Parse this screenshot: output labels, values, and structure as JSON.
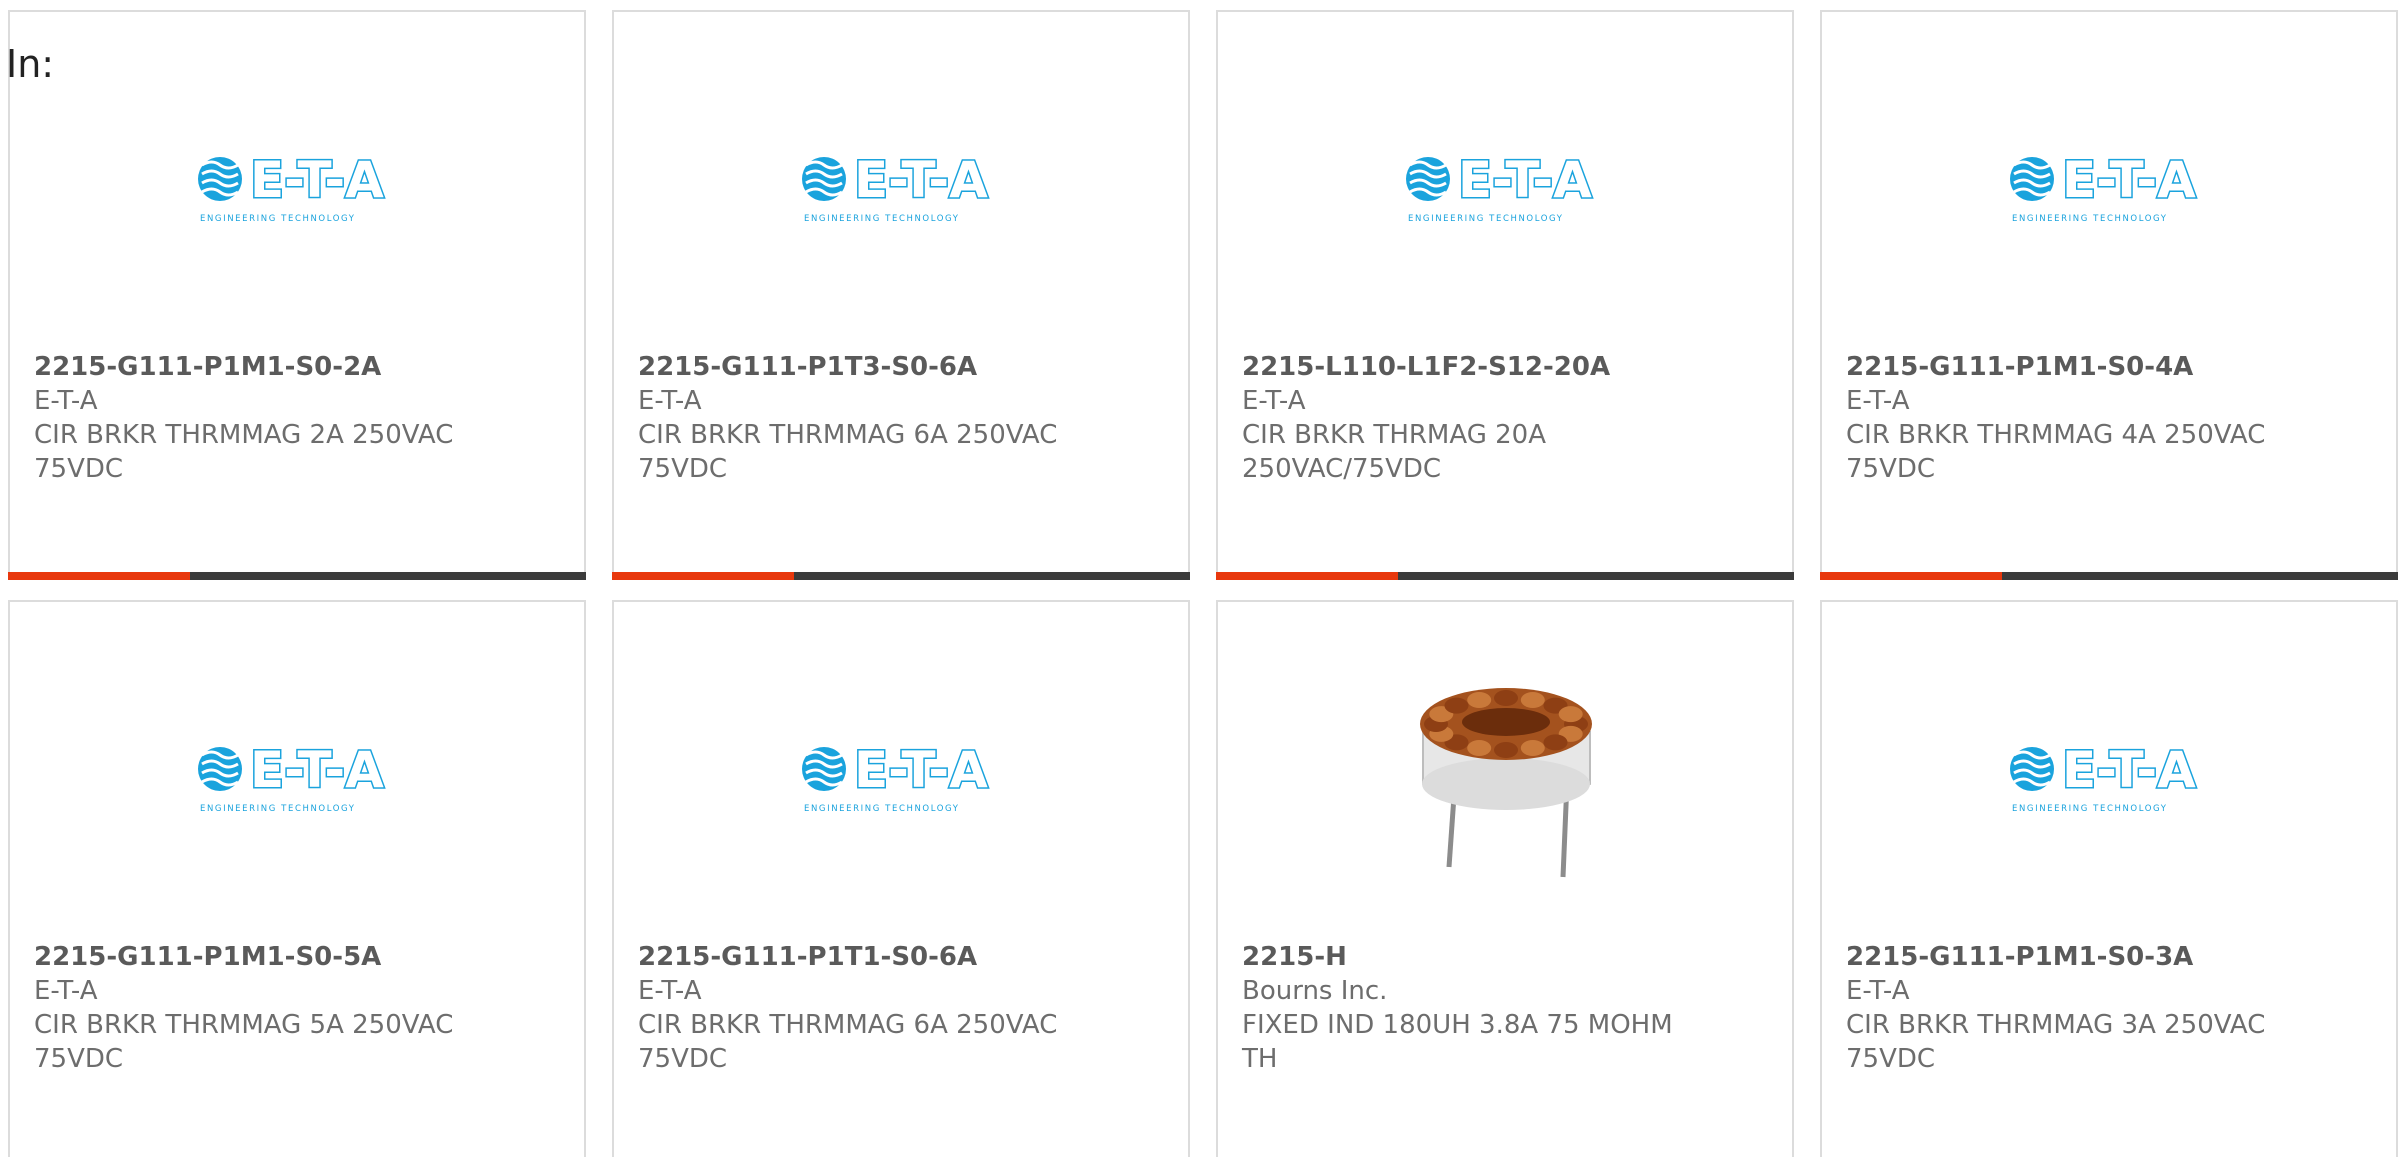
{
  "filter": {
    "label": "In:"
  },
  "colors": {
    "accent": "#e8380d",
    "bar": "#3b3b3b",
    "logo_blue": "#1aa3dd"
  },
  "products": [
    {
      "part": "2215-G111-P1M1-S0-2A",
      "maker": "E-T-A",
      "desc": "CIR BRKR THRMMAG 2A 250VAC 75VDC",
      "image": "eta-logo",
      "logo_text": "E-T-A",
      "logo_tagline": "ENGINEERING TECHNOLOGY"
    },
    {
      "part": "2215-G111-P1T3-S0-6A",
      "maker": "E-T-A",
      "desc": "CIR BRKR THRMMAG 6A 250VAC 75VDC",
      "image": "eta-logo",
      "logo_text": "E-T-A",
      "logo_tagline": "ENGINEERING TECHNOLOGY"
    },
    {
      "part": "2215-L110-L1F2-S12-20A",
      "maker": "E-T-A",
      "desc": "CIR BRKR THRMAG 20A 250VAC/75VDC",
      "image": "eta-logo",
      "logo_text": "E-T-A",
      "logo_tagline": "ENGINEERING TECHNOLOGY"
    },
    {
      "part": "2215-G111-P1M1-S0-4A",
      "maker": "E-T-A",
      "desc": "CIR BRKR THRMMAG 4A 250VAC 75VDC",
      "image": "eta-logo",
      "logo_text": "E-T-A",
      "logo_tagline": "ENGINEERING TECHNOLOGY"
    },
    {
      "part": "2215-G111-P1M1-S0-5A",
      "maker": "E-T-A",
      "desc": "CIR BRKR THRMMAG 5A 250VAC 75VDC",
      "image": "eta-logo",
      "logo_text": "E-T-A",
      "logo_tagline": "ENGINEERING TECHNOLOGY"
    },
    {
      "part": "2215-G111-P1T1-S0-6A",
      "maker": "E-T-A",
      "desc": "CIR BRKR THRMMAG 6A 250VAC 75VDC",
      "image": "eta-logo",
      "logo_text": "E-T-A",
      "logo_tagline": "ENGINEERING TECHNOLOGY"
    },
    {
      "part": "2215-H",
      "maker": "Bourns Inc.",
      "desc": "FIXED IND 180UH 3.8A 75 MOHM TH",
      "image": "toroid-inductor-photo"
    },
    {
      "part": "2215-G111-P1M1-S0-3A",
      "maker": "E-T-A",
      "desc": "CIR BRKR THRMMAG 3A 250VAC 75VDC",
      "image": "eta-logo",
      "logo_text": "E-T-A",
      "logo_tagline": "ENGINEERING TECHNOLOGY"
    }
  ]
}
